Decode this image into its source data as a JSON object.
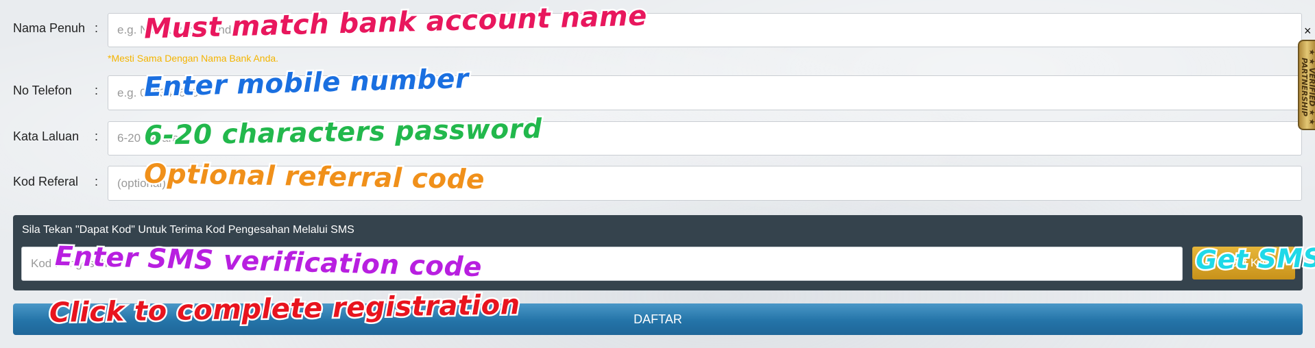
{
  "form": {
    "fields": [
      {
        "label": "Nama Penuh",
        "colon": ":",
        "placeholder": "e.g. Nama Penuh Anda",
        "annotation": "Must match bank account name"
      },
      {
        "label": "No Telefon",
        "colon": ":",
        "placeholder": "e.g. 0123456788",
        "annotation": "Enter mobile number"
      },
      {
        "label": "Kata Laluan",
        "colon": ":",
        "placeholder": "6-20 aksara",
        "annotation": "6-20 characters password"
      },
      {
        "label": "Kod Referal",
        "colon": ":",
        "placeholder": "(optional)",
        "annotation": "Optional referral code"
      }
    ],
    "name_hint": "*Mesti Sama Dengan Nama Bank Anda."
  },
  "sms": {
    "instruction": "Sila Tekan \"Dapat Kod\" Untuk Terima Kod Pengesahan Melalui SMS",
    "placeholder": "Kod Pengesahan",
    "annotation": "Enter SMS verification code",
    "button_label": "Dapat Kod",
    "button_annotation": "Get SMS"
  },
  "register": {
    "label": "DAFTAR",
    "annotation": "Click to complete registration"
  },
  "side_badge": {
    "close_glyph": "×",
    "text": "★ ★ VERIFIED ★ ★ PARTNERSHIP"
  },
  "colors": {
    "hint": "#f4b400",
    "panel": "#35434d",
    "button_gold": "#d4a02a",
    "button_blue": "#2474a8",
    "anno_name": "#e8175d",
    "anno_phone": "#1a6fe0",
    "anno_password": "#22b84c",
    "anno_referral": "#f0901a",
    "anno_sms": "#b81fe0",
    "anno_getsms": "#1fd9e8",
    "anno_register": "#e8141e"
  }
}
